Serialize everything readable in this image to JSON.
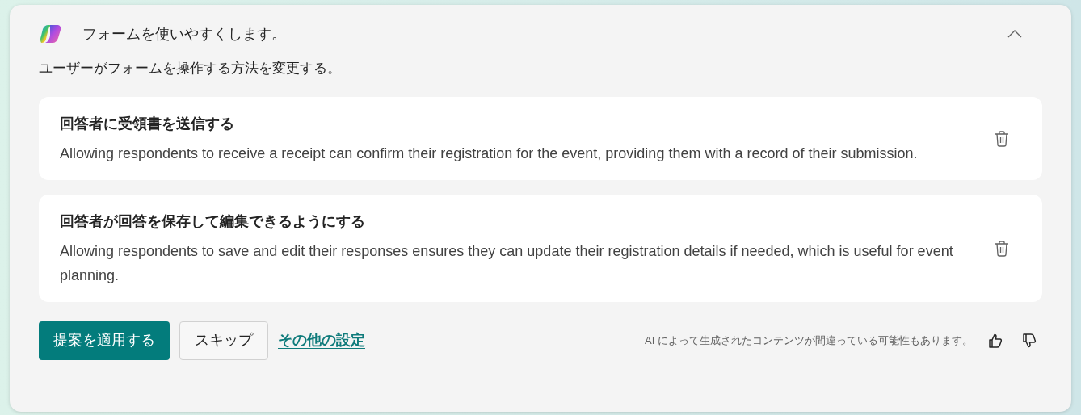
{
  "header": {
    "title": "フォームを使いやすくします。",
    "expanded": true
  },
  "subtitle": "ユーザーがフォームを操作する方法を変更する。",
  "suggestions": [
    {
      "title": "回答者に受領書を送信する",
      "description": "Allowing respondents to receive a receipt can confirm their registration for the event, providing them with a record of their submission."
    },
    {
      "title": "回答者が回答を保存して編集できるようにする",
      "description": "Allowing respondents to save and edit their responses ensures they can update their registration details if needed, which is useful for event planning."
    }
  ],
  "actions": {
    "apply": "提案を適用する",
    "skip": "スキップ",
    "more": "その他の設定"
  },
  "disclaimer": "AI によって生成されたコンテンツが間違っている可能性もあります。"
}
